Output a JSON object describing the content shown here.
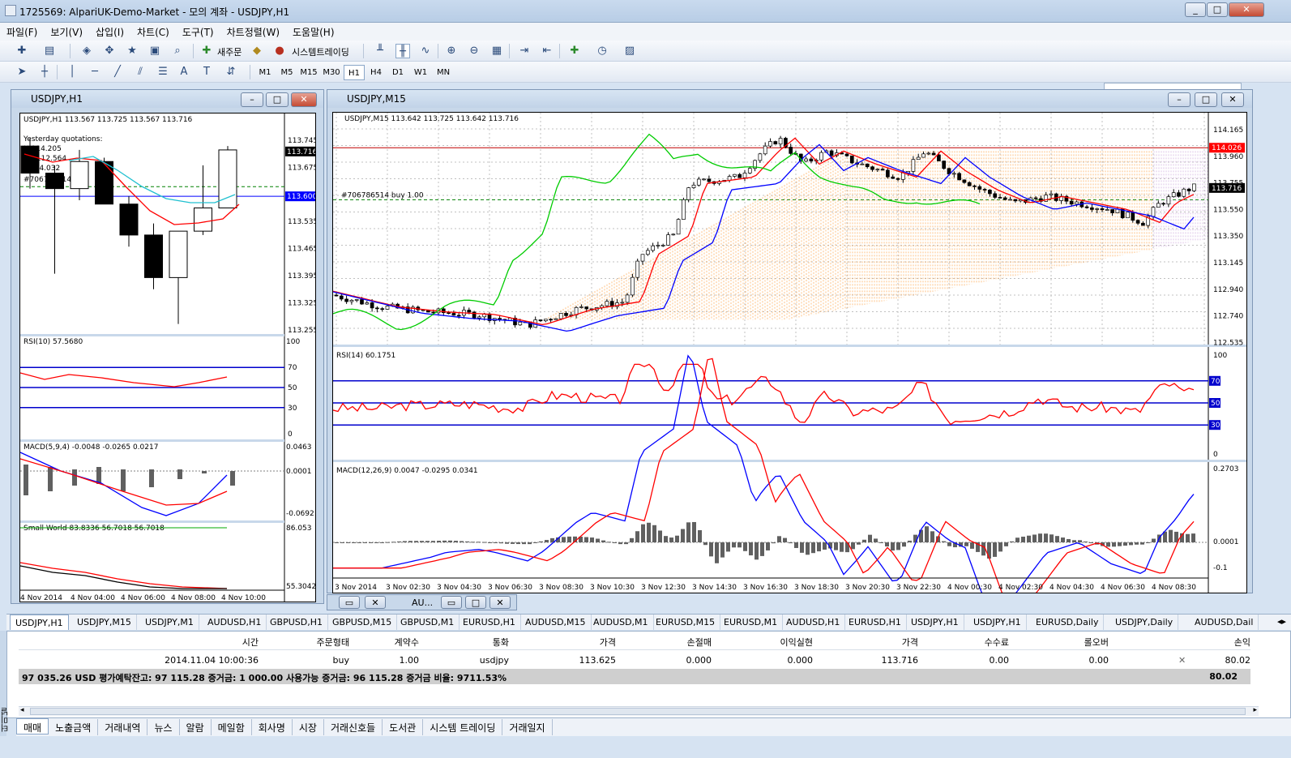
{
  "app": {
    "title": "1725569: AlpariUK-Demo-Market - 모의 계좌 - USDJPY,H1"
  },
  "menu": [
    "파일(F)",
    "보기(V)",
    "삽입(I)",
    "차트(C)",
    "도구(T)",
    "차트정렬(W)",
    "도움말(H)"
  ],
  "toolbar": {
    "new_order": "새주문",
    "auto_trading": "시스템트레이딩"
  },
  "timeframes": [
    "M1",
    "M5",
    "M15",
    "M30",
    "H1",
    "H4",
    "D1",
    "W1",
    "MN"
  ],
  "active_timeframe": "H1",
  "win_h1": {
    "title": "USDJPY,H1",
    "header": "USDJPY,H1  113.567 113.725 113.567 113.716",
    "yesterday": "Yesterday quotations:",
    "y_high": "H 114.205",
    "y_l1": "L 112.564",
    "y_l2": "114.032",
    "y_l3": "#706786514",
    "price_ticks": [
      "113.745",
      "113.675",
      "113.605",
      "113.535",
      "113.465",
      "113.395",
      "113.325",
      "113.255"
    ],
    "price_box": "113.716",
    "price_box2": "113.600",
    "rsi_label": "RSI(10) 57.5680",
    "rsi_levels": [
      "70",
      "50",
      "30",
      "0"
    ],
    "rsi_top": "100",
    "macd_label": "MACD(5,9,4) -0.0048 -0.0265 0.0217",
    "macd_ticks": [
      "0.0463",
      "0.0001",
      "-0.0692"
    ],
    "sw_label": "Small World 83.8336 56.7018 56.7018",
    "sw_ticks": [
      "86.053",
      "55.3042"
    ],
    "time_ticks": [
      "4 Nov 2014",
      "4 Nov 04:00",
      "4 Nov 06:00",
      "4 Nov 08:00",
      "4 Nov 10:00"
    ]
  },
  "win_m15": {
    "title": "USDJPY,M15",
    "header": "USDJPY,M15  113.642 113.725 113.642 113.716",
    "order_line": "#706786514 buy 1.00",
    "price_ticks": [
      "114.165",
      "113.960",
      "113.755",
      "113.550",
      "113.350",
      "113.145",
      "112.940",
      "112.740",
      "112.535"
    ],
    "price_red": "114.026",
    "price_black": "113.716",
    "rsi_label": "RSI(14) 60.1751",
    "rsi_levels": [
      "100",
      "70",
      "50",
      "30",
      "0"
    ],
    "macd_label": "MACD(12,26,9) 0.0047 -0.0295 0.0341",
    "macd_ticks": [
      "0.2703",
      "0.0001",
      "-0.1"
    ],
    "time_ticks": [
      "3 Nov 2014",
      "3 Nov 02:30",
      "3 Nov 04:30",
      "3 Nov 06:30",
      "3 Nov 08:30",
      "3 Nov 10:30",
      "3 Nov 12:30",
      "3 Nov 14:30",
      "3 Nov 16:30",
      "3 Nov 18:30",
      "3 Nov 20:30",
      "3 Nov 22:30",
      "4 Nov 00:30",
      "4 Nov 02:30",
      "4 Nov 04:30",
      "4 Nov 06:30",
      "4 Nov 08:30"
    ]
  },
  "min_win": {
    "label": "AU..."
  },
  "window_tabs": [
    "USDJPY,H1",
    "USDJPY,M15",
    "USDJPY,M1",
    "AUDUSD,H1",
    "GBPUSD,H1",
    "GBPUSD,M15",
    "GBPUSD,M1",
    "EURUSD,H1",
    "AUDUSD,M15",
    "AUDUSD,M1",
    "EURUSD,M15",
    "EURUSD,M1",
    "AUDUSD,H1",
    "EURUSD,H1",
    "USDJPY,H1",
    "USDJPY,H1",
    "EURUSD,Daily",
    "USDJPY,Daily",
    "AUDUSD,Dail"
  ],
  "terminal": {
    "headers": [
      "시간",
      "주문형태",
      "계약수",
      "통화",
      "가격",
      "손절매",
      "이익실현",
      "가격",
      "수수료",
      "롤오버",
      "손익"
    ],
    "row": [
      "2014.11.04 10:00:36",
      "buy",
      "1.00",
      "usdjpy",
      "113.625",
      "0.000",
      "0.000",
      "113.716",
      "0.00",
      "0.00",
      "80.02"
    ],
    "summary": "97 035.26 USD  평가예탁잔고: 97 115.28  증거금: 1 000.00  사용가능 증거금: 96 115.28  증거금 비율: 9711.53%",
    "summary_pl": "80.02",
    "side_label": "터미널"
  },
  "bottom_tabs": [
    "매매",
    "노출금액",
    "거래내역",
    "뉴스",
    "알람",
    "메일함",
    "회사명",
    "시장",
    "거래신호들",
    "도서관",
    "시스템 트레이딩",
    "거래일지"
  ],
  "colors": {
    "bull": "#ffffff",
    "bear": "#000000",
    "fast": "#ff0000",
    "slow": "#0000ff",
    "cyan": "#20c0d0",
    "green": "#00cc00",
    "cloud": "#ff9933"
  }
}
